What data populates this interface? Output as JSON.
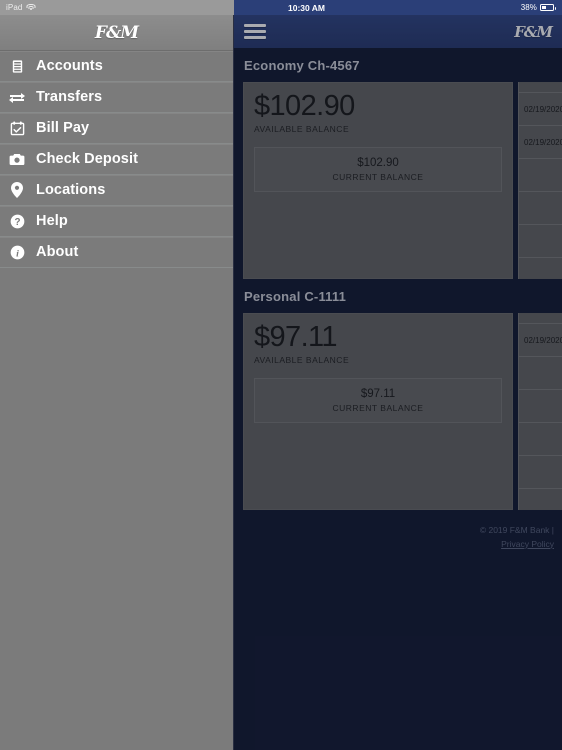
{
  "status_bar": {
    "device_label": "iPad",
    "wifi_icon": "wifi-icon",
    "time": "10:30 AM",
    "battery_percent": "38%",
    "battery_icon": "battery-icon"
  },
  "sidebar": {
    "logo_text": "F&M",
    "items": [
      {
        "label": "Accounts",
        "icon": "accounts-stack-icon"
      },
      {
        "label": "Transfers",
        "icon": "transfer-arrows-icon"
      },
      {
        "label": "Bill Pay",
        "icon": "calendar-check-icon"
      },
      {
        "label": "Check Deposit",
        "icon": "camera-icon"
      },
      {
        "label": "Locations",
        "icon": "map-pin-icon"
      },
      {
        "label": "Help",
        "icon": "question-circle-icon"
      },
      {
        "label": "About",
        "icon": "info-circle-icon"
      }
    ]
  },
  "navbar": {
    "menu_icon": "hamburger-menu-icon",
    "logo_text": "F&M"
  },
  "accounts": [
    {
      "title": "Economy Ch-4567",
      "available_balance": "$102.90",
      "available_caption": "AVAILABLE BALANCE",
      "current_balance": "$102.90",
      "current_caption": "CURRENT BALANCE",
      "transactions": [
        {
          "date": "02/19/2020"
        },
        {
          "date": "02/19/2020"
        },
        {
          "date": ""
        },
        {
          "date": ""
        },
        {
          "date": ""
        },
        {
          "date": ""
        }
      ]
    },
    {
      "title": "Personal C-1111",
      "available_balance": "$97.11",
      "available_caption": "AVAILABLE BALANCE",
      "current_balance": "$97.11",
      "current_caption": "CURRENT BALANCE",
      "transactions": [
        {
          "date": "02/19/2020"
        },
        {
          "date": ""
        },
        {
          "date": ""
        },
        {
          "date": ""
        },
        {
          "date": ""
        },
        {
          "date": ""
        }
      ]
    }
  ],
  "footer": {
    "copyright": "© 2019 F&M Bank |",
    "privacy_link": "Privacy Policy"
  },
  "colors": {
    "navy_bg": "#151c35",
    "header_blue": "#2b3f78",
    "sidebar_gray": "#7b7b7b",
    "card_gray": "#666666"
  }
}
